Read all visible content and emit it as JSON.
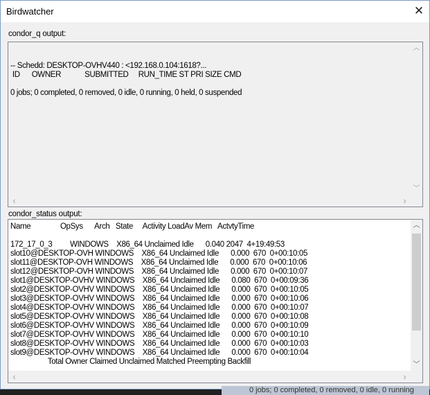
{
  "window": {
    "title": "Birdwatcher",
    "close_icon": "close-icon"
  },
  "condor_q": {
    "label": "condor_q output:",
    "lines": [
      "",
      "",
      "-- Schedd: DESKTOP-OVHV440 : <192.168.0.104:1618?...",
      " ID      OWNER            SUBMITTED     RUN_TIME ST PRI SIZE CMD",
      "",
      "0 jobs; 0 completed, 0 removed, 0 idle, 0 running, 0 held, 0 suspended"
    ]
  },
  "condor_status": {
    "label": "condor_status output:",
    "lines": [
      "Name               OpSys      Arch   State     Activity LoadAv Mem   ActvtyTime",
      "",
      "172_17_0_3         WINDOWS    X86_64 Unclaimed Idle      0.040 2047  4+19:49:53",
      "slot10@DESKTOP-OVH WINDOWS    X86_64 Unclaimed Idle      0.000  670  0+00:10:05",
      "slot11@DESKTOP-OVH WINDOWS    X86_64 Unclaimed Idle      0.000  670  0+00:10:06",
      "slot12@DESKTOP-OVH WINDOWS    X86_64 Unclaimed Idle      0.000  670  0+00:10:07",
      "slot1@DESKTOP-OVHV WINDOWS    X86_64 Unclaimed Idle      0.080  670  0+00:09:36",
      "slot2@DESKTOP-OVHV WINDOWS    X86_64 Unclaimed Idle      0.000  670  0+00:10:05",
      "slot3@DESKTOP-OVHV WINDOWS    X86_64 Unclaimed Idle      0.000  670  0+00:10:06",
      "slot4@DESKTOP-OVHV WINDOWS    X86_64 Unclaimed Idle      0.000  670  0+00:10:07",
      "slot5@DESKTOP-OVHV WINDOWS    X86_64 Unclaimed Idle      0.000  670  0+00:10:08",
      "slot6@DESKTOP-OVHV WINDOWS    X86_64 Unclaimed Idle      0.000  670  0+00:10:09",
      "slot7@DESKTOP-OVHV WINDOWS    X86_64 Unclaimed Idle      0.000  670  0+00:10:10",
      "slot8@DESKTOP-OVHV WINDOWS    X86_64 Unclaimed Idle      0.000  670  0+00:10:03",
      "slot9@DESKTOP-OVHV WINDOWS    X86_64 Unclaimed Idle      0.000  670  0+00:10:04",
      "                   Total Owner Claimed Unclaimed Matched Preempting Backfill"
    ]
  },
  "taskbar": {
    "text": "0 jobs; 0 completed, 0 removed, 0 idle, 0 running"
  }
}
